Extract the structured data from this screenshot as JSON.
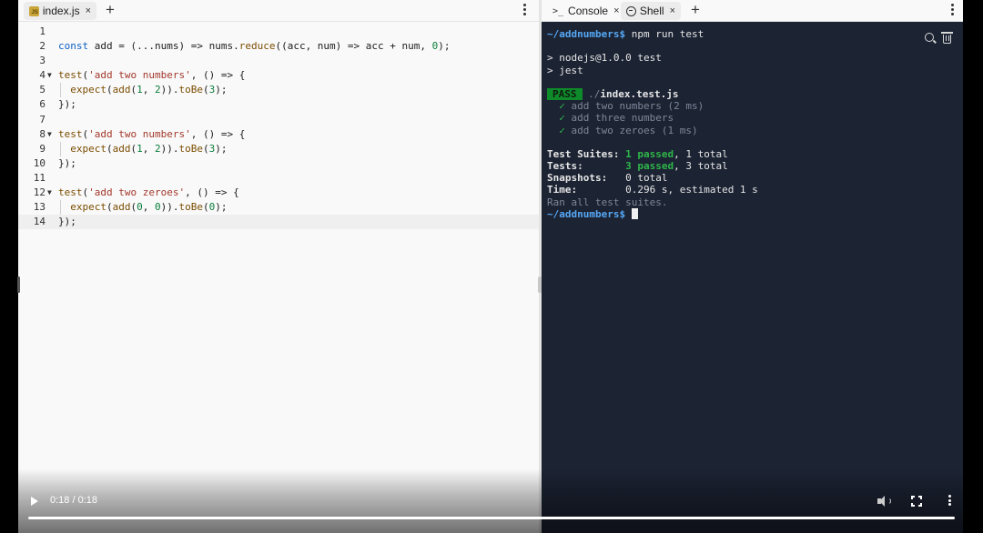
{
  "editor": {
    "tab": {
      "icon": "js-file-icon",
      "icon_text": "JS",
      "label": "index.js",
      "close": "×"
    },
    "add_tab": "+",
    "lines": [
      {
        "n": "1",
        "fold": "",
        "html": ""
      },
      {
        "n": "2",
        "fold": "",
        "html": "<span class=\"kw\">const</span> add = (...nums) => nums.<span class=\"fn\">reduce</span>((acc, num) => acc + num, <span class=\"num\">0</span>);"
      },
      {
        "n": "3",
        "fold": "",
        "html": ""
      },
      {
        "n": "4",
        "fold": "▼",
        "html": "<span class=\"fn\">test</span>(<span class=\"str\">'add two numbers'</span>, () => {"
      },
      {
        "n": "5",
        "fold": "",
        "html": "  <span class=\"fn\">expect</span>(<span class=\"fn\">add</span>(<span class=\"num\">1</span>, <span class=\"num\">2</span>)).<span class=\"fn\">toBe</span>(<span class=\"num\">3</span>);",
        "guide": true
      },
      {
        "n": "6",
        "fold": "",
        "html": "});"
      },
      {
        "n": "7",
        "fold": "",
        "html": ""
      },
      {
        "n": "8",
        "fold": "▼",
        "html": "<span class=\"fn\">test</span>(<span class=\"str\">'add two numbers'</span>, () => {"
      },
      {
        "n": "9",
        "fold": "",
        "html": "  <span class=\"fn\">expect</span>(<span class=\"fn\">add</span>(<span class=\"num\">1</span>, <span class=\"num\">2</span>)).<span class=\"fn\">toBe</span>(<span class=\"num\">3</span>);",
        "guide": true
      },
      {
        "n": "10",
        "fold": "",
        "html": "});"
      },
      {
        "n": "11",
        "fold": "",
        "html": ""
      },
      {
        "n": "12",
        "fold": "▼",
        "html": "<span class=\"fn\">test</span>(<span class=\"str\">'add two zeroes'</span>, () => {"
      },
      {
        "n": "13",
        "fold": "",
        "html": "  <span class=\"fn\">expect</span>(<span class=\"fn\">add</span>(<span class=\"num\">0</span>, <span class=\"num\">0</span>)).<span class=\"fn\">toBe</span>(<span class=\"num\">0</span>);",
        "guide": true
      },
      {
        "n": "14",
        "fold": "",
        "html": "});",
        "active": true
      }
    ]
  },
  "terminal": {
    "tabs": [
      {
        "icon": ">_",
        "label": "Console",
        "close": "×"
      },
      {
        "icon": "shell-icon",
        "label": "Shell",
        "close": "×"
      }
    ],
    "add_tab": "+",
    "lines": [
      "<span class=\"prompt\">~/addnumbers$</span> npm run test",
      "",
      "&gt; nodejs@1.0.0 test",
      "&gt; jest",
      "",
      "<span class=\"pass-badge\">PASS</span> <span class=\"dim\">./</span><span class=\"bold\">index.test.js</span>",
      "  <span class=\"check\">✓</span> <span class=\"dim\">add two numbers (2 ms)</span>",
      "  <span class=\"check\">✓</span> <span class=\"dim\">add three numbers</span>",
      "  <span class=\"check\">✓</span> <span class=\"dim\">add two zeroes (1 ms)</span>",
      "",
      "<span class=\"bold\">Test Suites:</span> <span class=\"green bold\">1 passed</span>, 1 total",
      "<span class=\"bold\">Tests:</span>       <span class=\"green bold\">3 passed</span>, 3 total",
      "<span class=\"bold\">Snapshots:</span>   0 total",
      "<span class=\"bold\">Time:</span>        0.296 s, estimated 1 s",
      "<span class=\"dim\">Ran all test suites.</span>",
      "<span class=\"prompt\">~/addnumbers$</span> <span class=\"cursor\"></span>"
    ]
  },
  "video": {
    "time": "0:18 / 0:18",
    "progress": 1.0,
    "icons": [
      "play-icon",
      "volume-icon",
      "fullscreen-icon",
      "more-icon"
    ]
  },
  "colors": {
    "terminal_bg": "#1c2333",
    "prompt": "#56a8f5",
    "pass": "#0e8a2a"
  }
}
